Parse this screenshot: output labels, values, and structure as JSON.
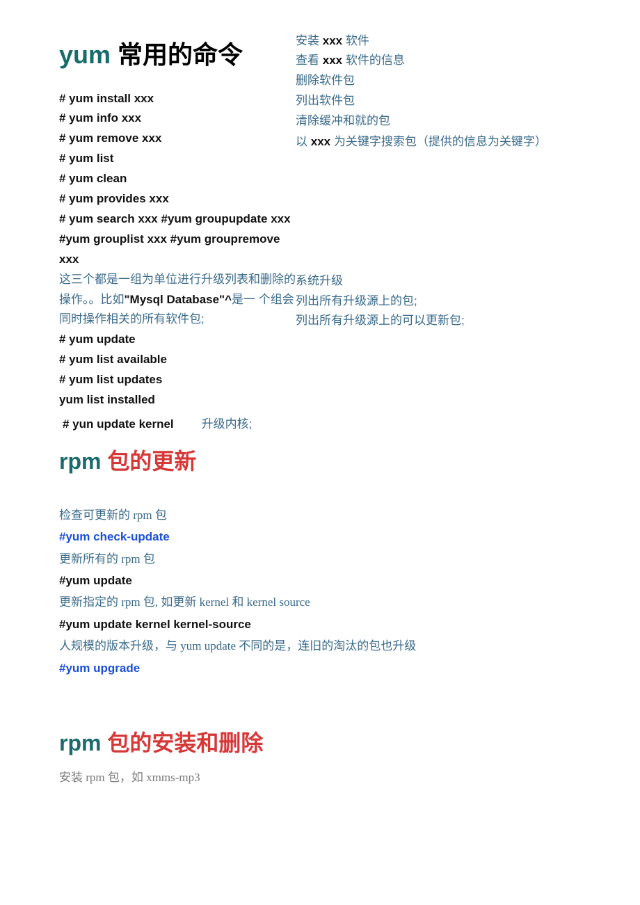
{
  "section1": {
    "title_accent": "yum ",
    "title_rest": "常用的命令",
    "left": {
      "cmds": [
        "# yum install xxx",
        "# yum info xxx",
        "# yum remove xxx",
        "# yum list",
        "# yum clean",
        "# yum provides xxx",
        "# yum search xxx #yum groupupdate xxx #yum grouplist xxx #yum groupremove xxx"
      ],
      "note_pre": "这三个都是一组为单位进行升级列表和删除的操作。。比如",
      "note_bold": "\"Mysql Database\"^",
      "note_post": "是一 个组会同时操作相关的所有软件包;",
      "cmds2": [
        "# yum update",
        "# yum list available",
        "# yum list updates",
        "yum list installed"
      ]
    },
    "right": {
      "d1_pre": "安装 ",
      "d1_b": "xxx",
      "d1_post": " 软件",
      "d2_pre": "查看 ",
      "d2_b": "xxx",
      "d2_post": " 软件的信息",
      "d3": "删除软件包",
      "d4": "列出软件包",
      "d5": "清除缓冲和就的包",
      "d6_pre": "以 ",
      "d6_b": "xxx",
      "d6_post": " 为关键字搜索包（提供的信息为关键字）",
      "d7": "系统升级",
      "d8": "列出所有升级源上的包;",
      "d9": "列出所有升级源上的可以更新包;"
    },
    "kernel_cmd": "# yun update kernel",
    "kernel_desc": "升级内核;"
  },
  "section2": {
    "title_accent": "rpm ",
    "title_rest": "包的更新",
    "lines": [
      {
        "type": "desc",
        "text": "检查可更新的 rpm 包"
      },
      {
        "type": "blue",
        "text": "#yum check-update"
      },
      {
        "type": "desc",
        "text": "更新所有的 rpm 包"
      },
      {
        "type": "black",
        "text": "#yum update"
      },
      {
        "type": "desc",
        "text": "更新指定的 rpm 包, 如更新 kernel 和 kernel source"
      },
      {
        "type": "black",
        "text": "#yum update kernel kernel-source"
      },
      {
        "type": "desc",
        "text": "人规模的版本升级，与 yum update 不同的是，连旧的淘汰的包也升级"
      },
      {
        "type": "blue",
        "text": "#yum upgrade"
      }
    ]
  },
  "section3": {
    "title_accent": "rpm ",
    "title_rest": "包的安装和删除",
    "line1": "安装 rpm 包，如 xmms-mp3"
  }
}
